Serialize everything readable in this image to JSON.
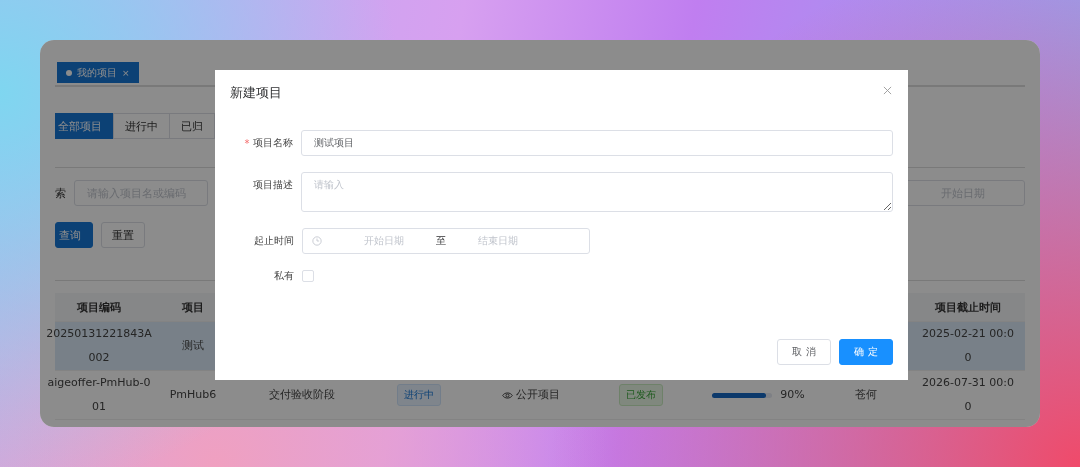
{
  "page_tabs": [
    {
      "label": "我的项目",
      "close": "×",
      "selected": true
    }
  ],
  "filter_tabs": [
    {
      "label": "全部项目",
      "selected": true
    },
    {
      "label": "进行中",
      "selected": false
    },
    {
      "label": "已归",
      "selected": false
    }
  ],
  "search": {
    "label": "索",
    "placeholder": "请输入项目名或编码"
  },
  "date_filter": {
    "placeholder": "开始日期"
  },
  "buttons": [
    {
      "label": "查询",
      "kind": "primary"
    },
    {
      "label": "重置",
      "kind": "default"
    }
  ],
  "table": {
    "columns": {
      "code": "项目编码",
      "name": "项目",
      "deadline": "项目截止时间"
    },
    "rows": [
      {
        "highlighted": true,
        "code": [
          "20250131221843A",
          "002"
        ],
        "name": "测试",
        "deadline": [
          "2025-02-21 00:0",
          "0"
        ]
      },
      {
        "highlighted": false,
        "code": [
          "aigeoffer-PmHub-0",
          "01"
        ],
        "name": "PmHub6",
        "stage": "交付验收阶段",
        "status": "进行中",
        "visibility": "公开项目",
        "publish": "已发布",
        "progress": {
          "level": 0.9,
          "reading": "90%"
        },
        "owner": "苍何",
        "deadline": [
          "2026-07-31 00:0",
          "0"
        ]
      }
    ]
  },
  "dialog": {
    "title": "新建项目",
    "fields": [
      {
        "kind": "text",
        "label": "项目名称",
        "required_mark": "*",
        "value": "测试项目"
      },
      {
        "kind": "textarea",
        "label": "项目描述",
        "placeholder": "请输入"
      },
      {
        "kind": "daterange",
        "label": "起止时间",
        "start_placeholder": "开始日期",
        "separator": "至",
        "end_placeholder": "结束日期"
      },
      {
        "kind": "checkbox",
        "label": "私有",
        "checked": false
      }
    ],
    "buttons": [
      {
        "label": "取 消",
        "kind": "default"
      },
      {
        "label": "确 定",
        "kind": "primary"
      }
    ]
  }
}
